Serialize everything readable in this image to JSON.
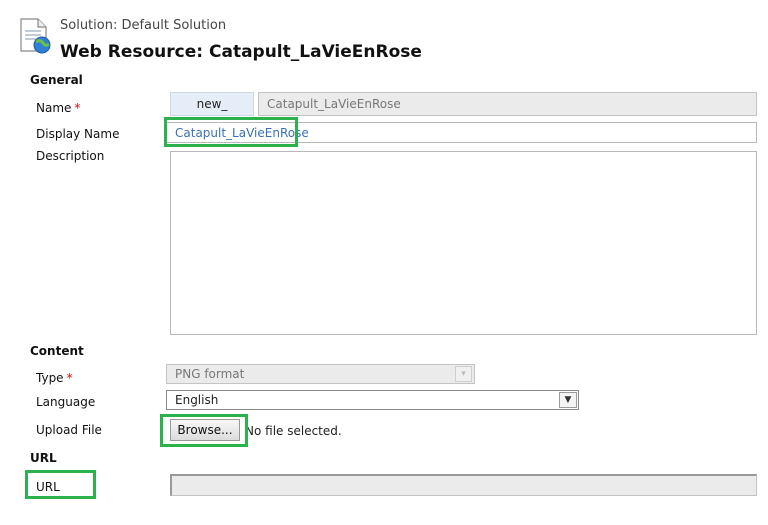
{
  "header": {
    "solution": "Solution: Default Solution",
    "title": "Web Resource: Catapult_LaVieEnRose"
  },
  "sections": {
    "general": "General",
    "content": "Content",
    "url": "URL"
  },
  "fields": {
    "name": {
      "label": "Name",
      "required": "*",
      "prefix": "new_",
      "value": "Catapult_LaVieEnRose"
    },
    "display_name": {
      "label": "Display Name",
      "value": "Catapult_LaVieEnRose"
    },
    "description": {
      "label": "Description",
      "value": ""
    },
    "type": {
      "label": "Type",
      "required": "*",
      "value": "PNG format"
    },
    "language": {
      "label": "Language",
      "value": "English"
    },
    "upload_file": {
      "label": "Upload File",
      "button": "Browse...",
      "status": "No file selected."
    },
    "url": {
      "label": "URL",
      "value": ""
    }
  },
  "colors": {
    "highlight": "#2bb24c",
    "link_text": "#3a6fb5",
    "required": "#e00000"
  }
}
